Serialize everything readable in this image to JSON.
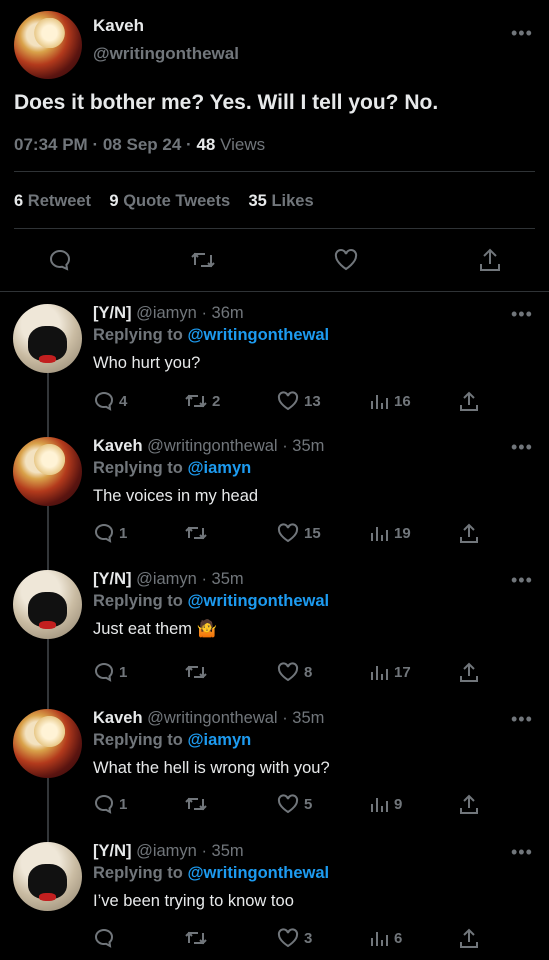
{
  "main_tweet": {
    "display_name": "Kaveh",
    "handle": "@writingonthewal",
    "text": "Does it bother me? Yes. Will I tell you? No.",
    "time": "07:34 PM",
    "date": "08 Sep 24",
    "views_count": "48",
    "views_label": "Views",
    "retweets_count": "6",
    "retweets_label": "Retweet",
    "quotes_count": "9",
    "quotes_label": "Quote Tweets",
    "likes_count": "35",
    "likes_label": "Likes",
    "separator": "·"
  },
  "replies": [
    {
      "name": "[Y/N]",
      "handle": "@iamyn",
      "time": "36m",
      "replying_label": "Replying to",
      "replying_to": "@writingonthewal",
      "text": "Who hurt you?",
      "replies": "4",
      "retweets": "2",
      "likes": "13",
      "views": "16"
    },
    {
      "name": "Kaveh",
      "handle": "@writingonthewal",
      "time": "35m",
      "replying_label": "Replying to",
      "replying_to": "@iamyn",
      "text": "The voices in my head",
      "replies": "1",
      "retweets": "",
      "likes": "15",
      "views": "19"
    },
    {
      "name": "[Y/N]",
      "handle": "@iamyn",
      "time": "35m",
      "replying_label": "Replying to",
      "replying_to": "@writingonthewal",
      "text": "Just eat them 🤷",
      "replies": "1",
      "retweets": "",
      "likes": "8",
      "views": "17"
    },
    {
      "name": "Kaveh",
      "handle": "@writingonthewal",
      "time": "35m",
      "replying_label": "Replying to",
      "replying_to": "@iamyn",
      "text": "What the hell is wrong with you?",
      "replies": "1",
      "retweets": "",
      "likes": "5",
      "views": "9"
    },
    {
      "name": "[Y/N]",
      "handle": "@iamyn",
      "time": "35m",
      "replying_label": "Replying to",
      "replying_to": "@writingonthewal",
      "text": "I’ve been trying to know too",
      "replies": "",
      "retweets": "",
      "likes": "3",
      "views": "6"
    }
  ],
  "icons": {
    "reply": "speech-bubble-icon",
    "retweet": "retweet-arrows-icon",
    "like": "heart-icon",
    "views": "bar-chart-icon",
    "share": "share-upload-icon",
    "more": "more-dots-icon"
  },
  "colors": {
    "background": "#000000",
    "text": "#e7e9ea",
    "muted": "#71767b",
    "link": "#1d9bf0",
    "divider": "#2f3336"
  }
}
